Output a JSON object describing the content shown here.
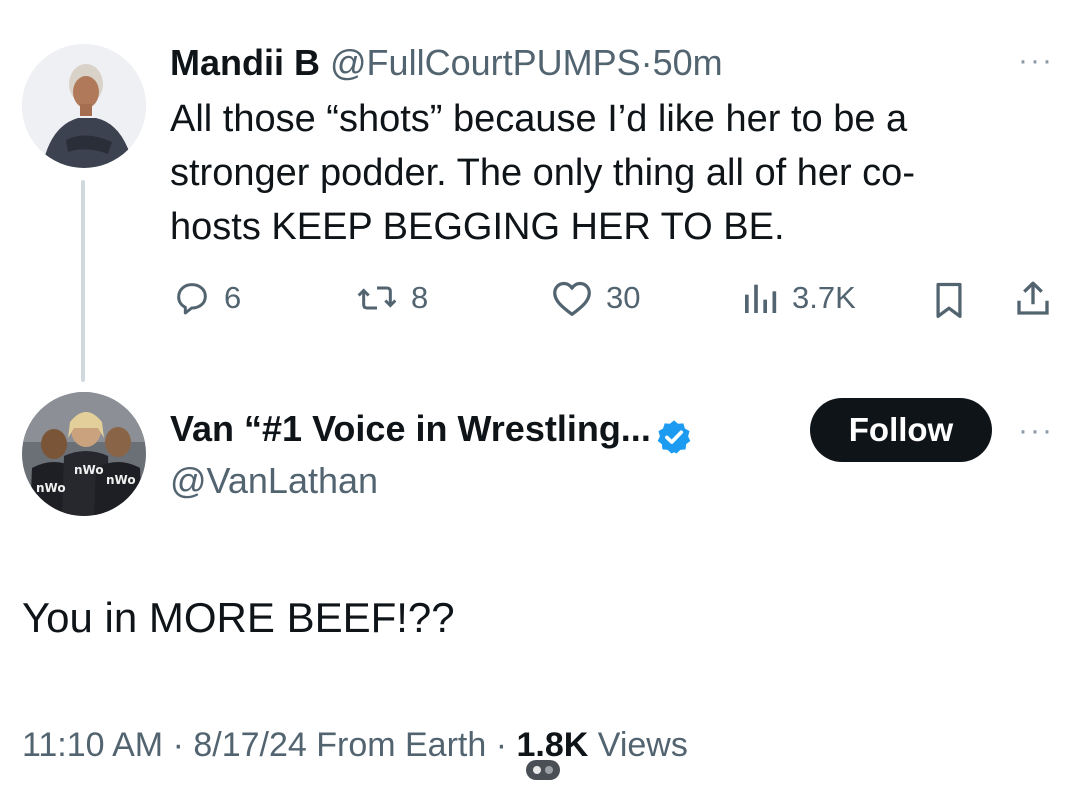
{
  "quoted_tweet": {
    "display_name": "Mandii B",
    "handle": "@FullCourtPUMPS",
    "separator": "·",
    "time_ago": "50m",
    "text_lines": [
      "All those “shots” because I’d like her to be a",
      "stronger podder. The only thing all of her co-",
      "hosts KEEP BEGGING HER TO BE."
    ],
    "replies": "6",
    "reposts": "8",
    "likes": "30",
    "views": "3.7K",
    "more": "···"
  },
  "main_tweet": {
    "display_name": "Van “#1 Voice in Wrestling...",
    "handle": "@VanLathan",
    "verified": true,
    "follow_label": "Follow",
    "more": "···",
    "text": "You in MORE BEEF!??",
    "timestamp": "11:10 AM · 8/17/24 From Earth ·",
    "views_count": "1.8K",
    "views_label": "Views",
    "avatar_shirt_text": "nWo"
  },
  "colors": {
    "text": "#0f1419",
    "muted": "#536471",
    "verified_blue": "#1d9bf0",
    "thread_line": "#cfd9de"
  }
}
